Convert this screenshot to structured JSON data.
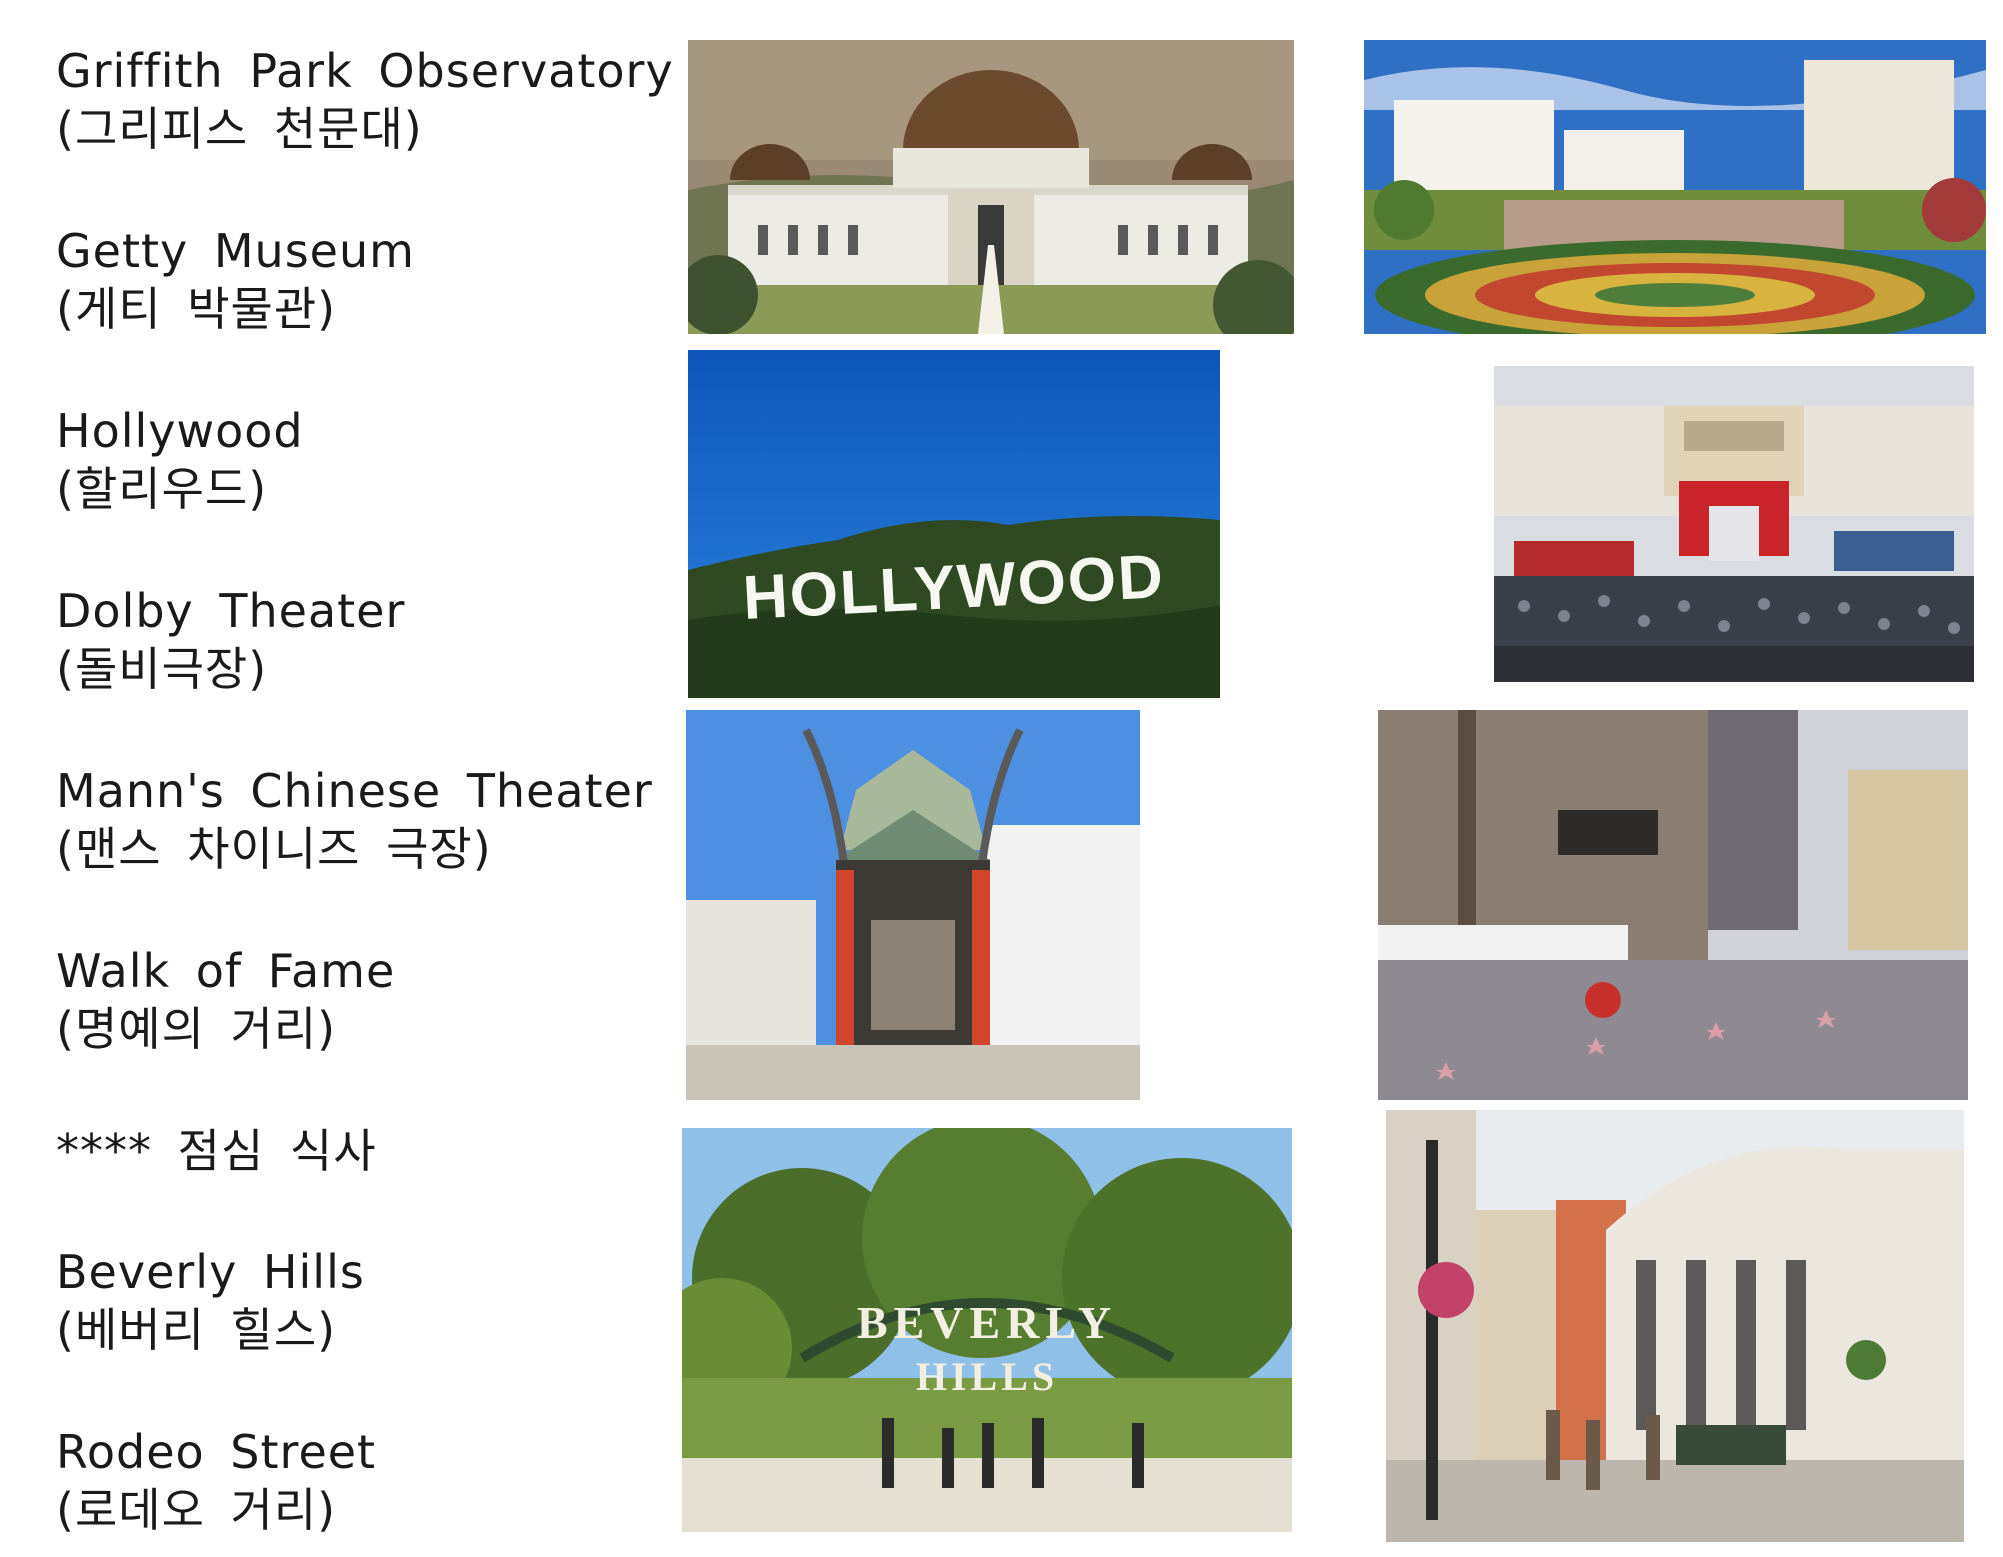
{
  "places": [
    {
      "name": "Griffith Park Observatory",
      "korean": "(그리피스 천문대)"
    },
    {
      "name": "Getty Museum",
      "korean": "(게티 박물관)"
    },
    {
      "name": "Hollywood",
      "korean": "(할리우드)"
    },
    {
      "name": "Dolby Theater",
      "korean": "(돌비극장)"
    },
    {
      "name": "Mann's Chinese Theater",
      "korean": "(맨스 차이니즈 극장)"
    },
    {
      "name": "Walk of Fame",
      "korean": "(명예의 거리)"
    },
    {
      "name": "**** 점심 식사",
      "korean": ""
    },
    {
      "name": "Beverly Hills",
      "korean": "(베버리 힐스)"
    },
    {
      "name": "Rodeo Street",
      "korean": "(로데오 거리)"
    }
  ],
  "photo_text": {
    "hollywood_sign": "HOLLYWOOD",
    "beverly_sign_top": "BEVERLY",
    "beverly_sign_bottom": "HILLS"
  }
}
